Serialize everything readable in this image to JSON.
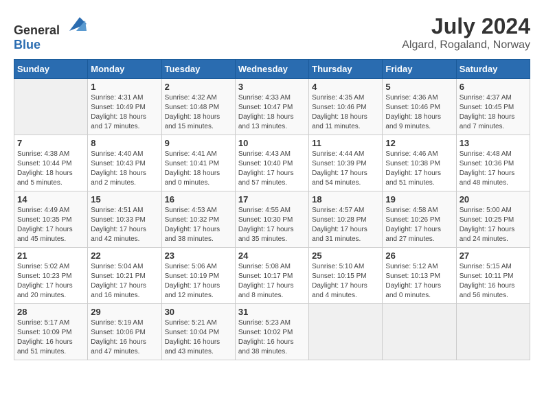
{
  "logo": {
    "general": "General",
    "blue": "Blue"
  },
  "title": "July 2024",
  "subtitle": "Algard, Rogaland, Norway",
  "days_header": [
    "Sunday",
    "Monday",
    "Tuesday",
    "Wednesday",
    "Thursday",
    "Friday",
    "Saturday"
  ],
  "weeks": [
    [
      {
        "day": "",
        "info": ""
      },
      {
        "day": "1",
        "info": "Sunrise: 4:31 AM\nSunset: 10:49 PM\nDaylight: 18 hours\nand 17 minutes."
      },
      {
        "day": "2",
        "info": "Sunrise: 4:32 AM\nSunset: 10:48 PM\nDaylight: 18 hours\nand 15 minutes."
      },
      {
        "day": "3",
        "info": "Sunrise: 4:33 AM\nSunset: 10:47 PM\nDaylight: 18 hours\nand 13 minutes."
      },
      {
        "day": "4",
        "info": "Sunrise: 4:35 AM\nSunset: 10:46 PM\nDaylight: 18 hours\nand 11 minutes."
      },
      {
        "day": "5",
        "info": "Sunrise: 4:36 AM\nSunset: 10:46 PM\nDaylight: 18 hours\nand 9 minutes."
      },
      {
        "day": "6",
        "info": "Sunrise: 4:37 AM\nSunset: 10:45 PM\nDaylight: 18 hours\nand 7 minutes."
      }
    ],
    [
      {
        "day": "7",
        "info": "Sunrise: 4:38 AM\nSunset: 10:44 PM\nDaylight: 18 hours\nand 5 minutes."
      },
      {
        "day": "8",
        "info": "Sunrise: 4:40 AM\nSunset: 10:43 PM\nDaylight: 18 hours\nand 2 minutes."
      },
      {
        "day": "9",
        "info": "Sunrise: 4:41 AM\nSunset: 10:41 PM\nDaylight: 18 hours\nand 0 minutes."
      },
      {
        "day": "10",
        "info": "Sunrise: 4:43 AM\nSunset: 10:40 PM\nDaylight: 17 hours\nand 57 minutes."
      },
      {
        "day": "11",
        "info": "Sunrise: 4:44 AM\nSunset: 10:39 PM\nDaylight: 17 hours\nand 54 minutes."
      },
      {
        "day": "12",
        "info": "Sunrise: 4:46 AM\nSunset: 10:38 PM\nDaylight: 17 hours\nand 51 minutes."
      },
      {
        "day": "13",
        "info": "Sunrise: 4:48 AM\nSunset: 10:36 PM\nDaylight: 17 hours\nand 48 minutes."
      }
    ],
    [
      {
        "day": "14",
        "info": "Sunrise: 4:49 AM\nSunset: 10:35 PM\nDaylight: 17 hours\nand 45 minutes."
      },
      {
        "day": "15",
        "info": "Sunrise: 4:51 AM\nSunset: 10:33 PM\nDaylight: 17 hours\nand 42 minutes."
      },
      {
        "day": "16",
        "info": "Sunrise: 4:53 AM\nSunset: 10:32 PM\nDaylight: 17 hours\nand 38 minutes."
      },
      {
        "day": "17",
        "info": "Sunrise: 4:55 AM\nSunset: 10:30 PM\nDaylight: 17 hours\nand 35 minutes."
      },
      {
        "day": "18",
        "info": "Sunrise: 4:57 AM\nSunset: 10:28 PM\nDaylight: 17 hours\nand 31 minutes."
      },
      {
        "day": "19",
        "info": "Sunrise: 4:58 AM\nSunset: 10:26 PM\nDaylight: 17 hours\nand 27 minutes."
      },
      {
        "day": "20",
        "info": "Sunrise: 5:00 AM\nSunset: 10:25 PM\nDaylight: 17 hours\nand 24 minutes."
      }
    ],
    [
      {
        "day": "21",
        "info": "Sunrise: 5:02 AM\nSunset: 10:23 PM\nDaylight: 17 hours\nand 20 minutes."
      },
      {
        "day": "22",
        "info": "Sunrise: 5:04 AM\nSunset: 10:21 PM\nDaylight: 17 hours\nand 16 minutes."
      },
      {
        "day": "23",
        "info": "Sunrise: 5:06 AM\nSunset: 10:19 PM\nDaylight: 17 hours\nand 12 minutes."
      },
      {
        "day": "24",
        "info": "Sunrise: 5:08 AM\nSunset: 10:17 PM\nDaylight: 17 hours\nand 8 minutes."
      },
      {
        "day": "25",
        "info": "Sunrise: 5:10 AM\nSunset: 10:15 PM\nDaylight: 17 hours\nand 4 minutes."
      },
      {
        "day": "26",
        "info": "Sunrise: 5:12 AM\nSunset: 10:13 PM\nDaylight: 17 hours\nand 0 minutes."
      },
      {
        "day": "27",
        "info": "Sunrise: 5:15 AM\nSunset: 10:11 PM\nDaylight: 16 hours\nand 56 minutes."
      }
    ],
    [
      {
        "day": "28",
        "info": "Sunrise: 5:17 AM\nSunset: 10:09 PM\nDaylight: 16 hours\nand 51 minutes."
      },
      {
        "day": "29",
        "info": "Sunrise: 5:19 AM\nSunset: 10:06 PM\nDaylight: 16 hours\nand 47 minutes."
      },
      {
        "day": "30",
        "info": "Sunrise: 5:21 AM\nSunset: 10:04 PM\nDaylight: 16 hours\nand 43 minutes."
      },
      {
        "day": "31",
        "info": "Sunrise: 5:23 AM\nSunset: 10:02 PM\nDaylight: 16 hours\nand 38 minutes."
      },
      {
        "day": "",
        "info": ""
      },
      {
        "day": "",
        "info": ""
      },
      {
        "day": "",
        "info": ""
      }
    ]
  ]
}
